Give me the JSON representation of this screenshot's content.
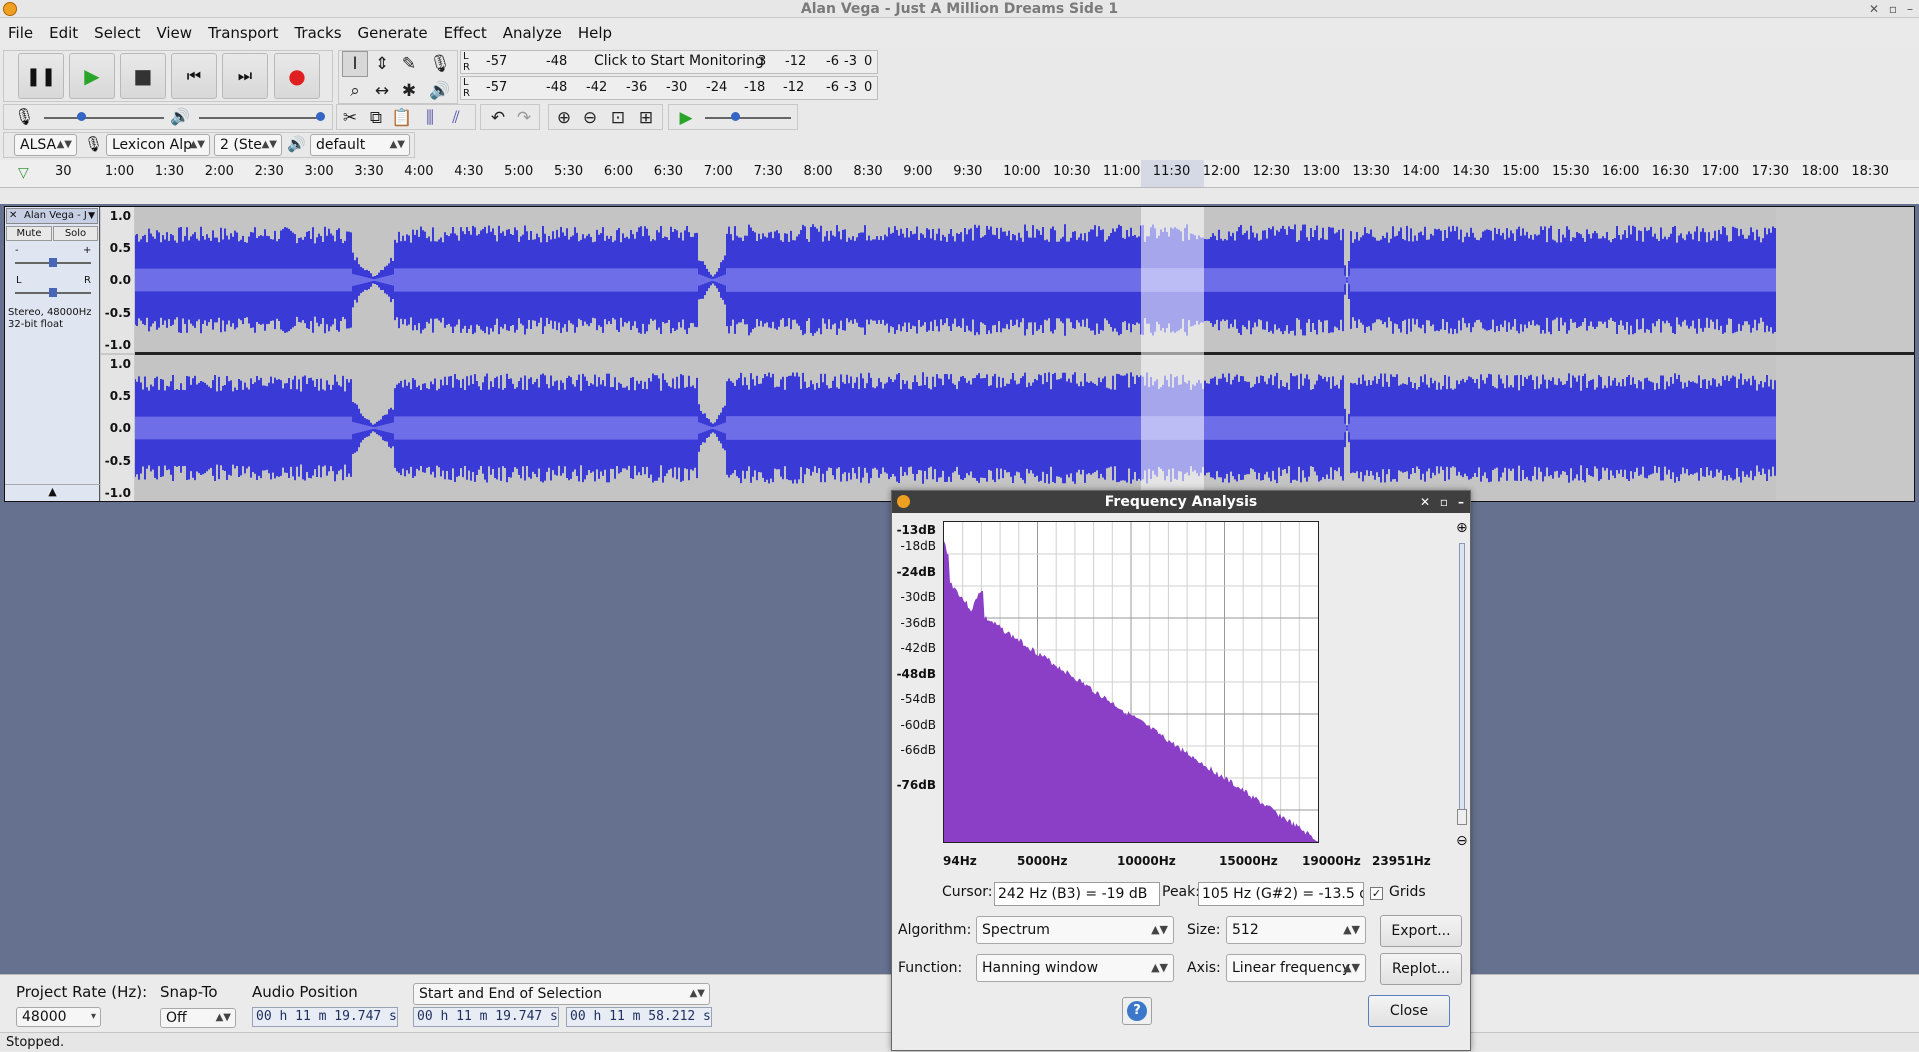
{
  "window": {
    "title": "Alan Vega - Just A Million Dreams Side 1"
  },
  "menu": [
    "File",
    "Edit",
    "Select",
    "View",
    "Transport",
    "Tracks",
    "Generate",
    "Effect",
    "Analyze",
    "Help"
  ],
  "meters": {
    "record_ticks": [
      "-57",
      "-48"
    ],
    "record_hint": "Click to Start Monitoring",
    "record_ticks_right": [
      "3",
      "-12",
      "-6",
      "-3",
      "0"
    ],
    "play_ticks": [
      "-57",
      "-48",
      "-42",
      "-36",
      "-30",
      "-24",
      "-18",
      "-12",
      "-6",
      "-3",
      "0"
    ],
    "lr": [
      "L",
      "R"
    ]
  },
  "device": {
    "host": "ALSA",
    "input": "Lexicon Alp",
    "channels": "2 (Ste",
    "output": "default"
  },
  "ruler": [
    "30",
    "1:00",
    "1:30",
    "2:00",
    "2:30",
    "3:00",
    "3:30",
    "4:00",
    "4:30",
    "5:00",
    "5:30",
    "6:00",
    "6:30",
    "7:00",
    "7:30",
    "8:00",
    "8:30",
    "9:00",
    "9:30",
    "10:00",
    "10:30",
    "11:00",
    "11:30",
    "12:00",
    "12:30",
    "13:00",
    "13:30",
    "14:00",
    "14:30",
    "15:00",
    "15:30",
    "16:00",
    "16:30",
    "17:00",
    "17:30",
    "18:00",
    "18:30"
  ],
  "track": {
    "name": "Alan Vega - J",
    "mute": "Mute",
    "solo": "Solo",
    "info1": "Stereo, 48000Hz",
    "info2": "32-bit float",
    "gain_minus": "-",
    "gain_plus": "+",
    "pan_l": "L",
    "pan_r": "R",
    "scale": [
      "1.0",
      "0.5",
      "0.0",
      "-0.5",
      "-1.0"
    ]
  },
  "bottom": {
    "rate_label": "Project Rate (Hz):",
    "rate_value": "48000",
    "snap_label": "Snap-To",
    "snap_value": "Off",
    "audio_pos_label": "Audio Position",
    "audio_pos_value": "00 h 11 m 19.747 s",
    "selection_mode": "Start and End of Selection",
    "sel_start": "00 h 11 m 19.747 s",
    "sel_end": "00 h 11 m 58.212 s"
  },
  "status": "Stopped.",
  "freq": {
    "title": "Frequency Analysis",
    "db_labels": [
      "-13dB",
      "-18dB",
      "-24dB",
      "-30dB",
      "-36dB",
      "-42dB",
      "-48dB",
      "-54dB",
      "-60dB",
      "-66dB",
      "-76dB"
    ],
    "hz_labels": [
      "94Hz",
      "5000Hz",
      "10000Hz",
      "15000Hz",
      "19000Hz",
      "23951Hz"
    ],
    "cursor_label": "Cursor:",
    "cursor_value": "242 Hz (B3) = -19 dB",
    "peak_label": "Peak:",
    "peak_value": "105 Hz (G#2) = -13.5 d",
    "grids_label": "Grids",
    "algorithm_label": "Algorithm:",
    "algorithm_value": "Spectrum",
    "size_label": "Size:",
    "size_value": "512",
    "function_label": "Function:",
    "function_value": "Hanning window",
    "axis_label": "Axis:",
    "axis_value": "Linear frequency",
    "export": "Export...",
    "replot": "Replot...",
    "help": "?",
    "close": "Close",
    "spectrum_color": "#8a3fc6"
  },
  "colors": {
    "wave": "#3a3ad6",
    "wave_rms": "#6e6ee8",
    "track_bg": "#66708f"
  }
}
